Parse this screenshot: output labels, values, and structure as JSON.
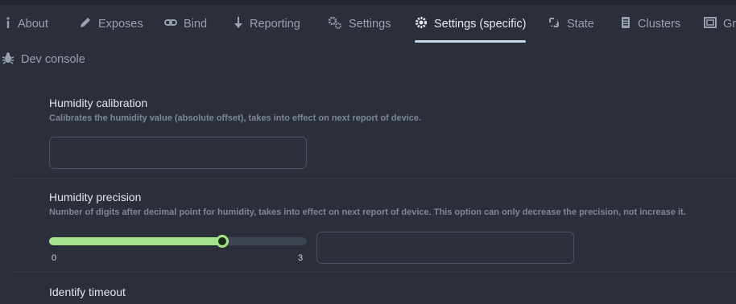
{
  "tabs": [
    {
      "label": "About",
      "icon": "info-icon"
    },
    {
      "label": "Exposes",
      "icon": "pencil-icon"
    },
    {
      "label": "Bind",
      "icon": "link-icon"
    },
    {
      "label": "Reporting",
      "icon": "arrow-down-icon"
    },
    {
      "label": "Settings",
      "icon": "gears-icon"
    },
    {
      "label": "Settings (specific)",
      "icon": "gear-icon",
      "active": true
    },
    {
      "label": "State",
      "icon": "refresh-icon"
    },
    {
      "label": "Clusters",
      "icon": "document-icon"
    },
    {
      "label": "Gr",
      "icon": "group-icon"
    },
    {
      "label": "Dev console",
      "icon": "bug-icon"
    }
  ],
  "settings": {
    "humidity_calibration": {
      "title": "Humidity calibration",
      "description": "Calibrates the humidity value (absolute offset), takes into effect on next report of device.",
      "value": ""
    },
    "humidity_precision": {
      "title": "Humidity precision",
      "description": "Number of digits after decimal point for humidity, takes into effect on next report of device. This option can only decrease the precision, not increase it.",
      "slider_min_label": "0",
      "slider_max_label": "3",
      "slider_min": 0,
      "slider_max": 3,
      "slider_value": 2,
      "value": ""
    },
    "identify_timeout": {
      "title": "Identify timeout"
    }
  },
  "colors": {
    "background": "#2a2f3a",
    "accent_underline": "#c6d9ea",
    "slider_fill": "#a6e58e"
  }
}
